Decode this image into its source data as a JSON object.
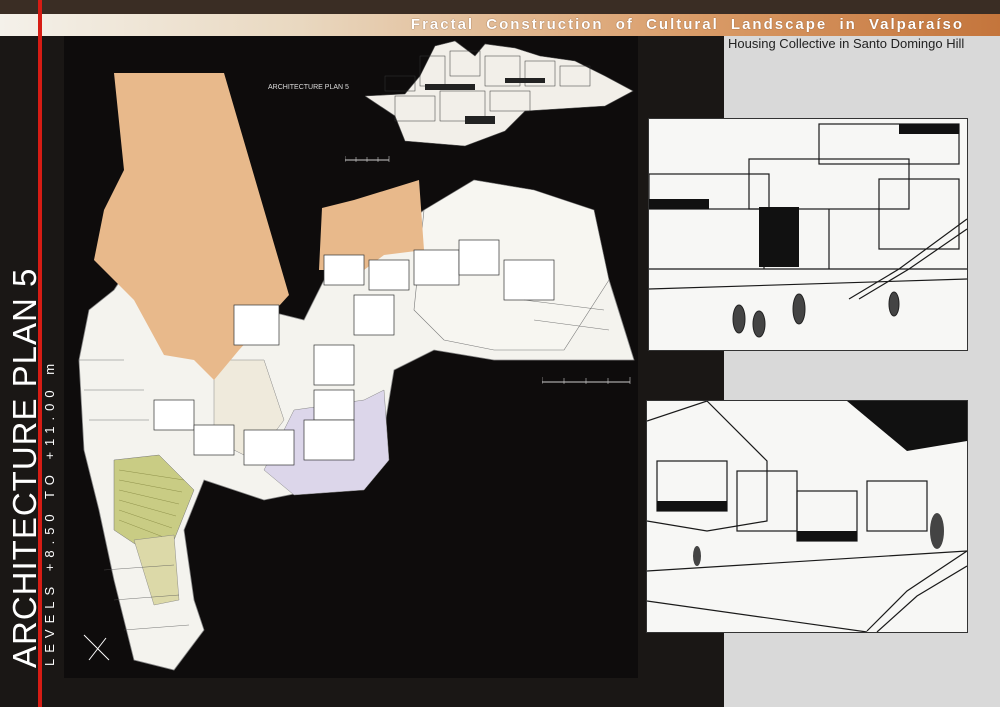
{
  "header": {
    "title": "Fractal Construction of Cultural Landscape in Valparaíso",
    "subtitle": "Housing Collective in Santo Domingo Hill"
  },
  "side_title": {
    "main": "ARCHITECTURE PLAN 5",
    "levels": "LEVELS +8.50 TO +11.00 m"
  },
  "elevation_label": "ARCHITECTURE PLAN 5",
  "colors": {
    "accent_red": "#d61c14",
    "title_gradient_end": "#c4753c",
    "terrain": "#e8b98b",
    "background": "#1a1715",
    "right_panel": "#d9d9d9"
  },
  "icons": [
    "north-arrow-icon",
    "scale-bar-icon"
  ]
}
